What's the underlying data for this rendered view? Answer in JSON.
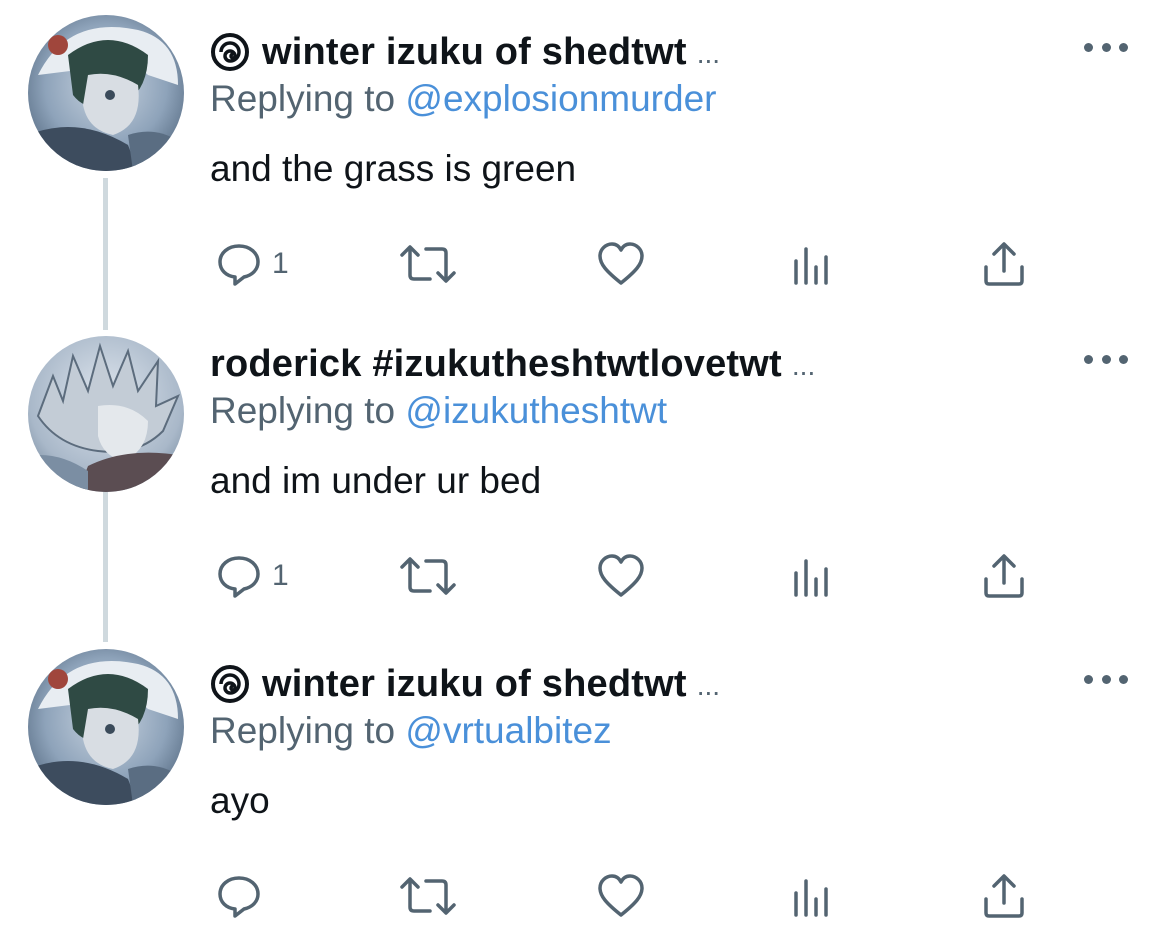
{
  "tweets": [
    {
      "author": "winter izuku of shedtwt",
      "has_swirl": true,
      "ellipsis": "...",
      "replying_prefix": "Replying to",
      "replying_to": "@explosionmurder",
      "text": "and the grass is green",
      "reply_count": "1",
      "avatar": "izuku-avatar"
    },
    {
      "author": "roderick #izukutheshtwtlovetwt",
      "has_swirl": false,
      "ellipsis": "...",
      "replying_prefix": "Replying to",
      "replying_to": "@izukutheshtwt",
      "text": "and im under ur bed",
      "reply_count": "1",
      "avatar": "bakugo-avatar"
    },
    {
      "author": "winter izuku of shedtwt",
      "has_swirl": true,
      "ellipsis": "...",
      "replying_prefix": "Replying to",
      "replying_to": "@vrtualbitez",
      "text": "ayo",
      "reply_count": "",
      "avatar": "izuku-avatar"
    }
  ],
  "icons": {
    "reply": "reply-icon",
    "retweet": "retweet-icon",
    "like": "heart-icon",
    "views": "views-icon",
    "share": "share-icon",
    "more": "more-icon"
  },
  "colors": {
    "mention": "#4a90d9",
    "secondary_text": "#536471",
    "thread_line": "#cfd9de"
  }
}
